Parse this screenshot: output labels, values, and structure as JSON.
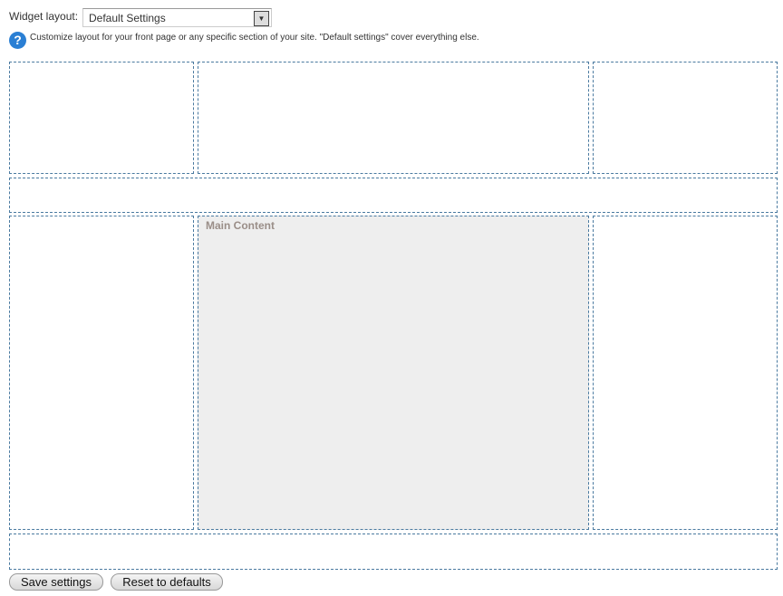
{
  "widget_layout": {
    "label": "Widget layout:",
    "selected": "Default Settings"
  },
  "hint": "Customize layout for your front page or any specific section of your site. \"Default settings\" cover everything else.",
  "main_content_label": "Main Content",
  "buttons": {
    "save": "Save settings",
    "reset": "Reset to defaults"
  },
  "colors": {
    "border": "#4a7aa0",
    "main_bg": "#eeeeee"
  }
}
